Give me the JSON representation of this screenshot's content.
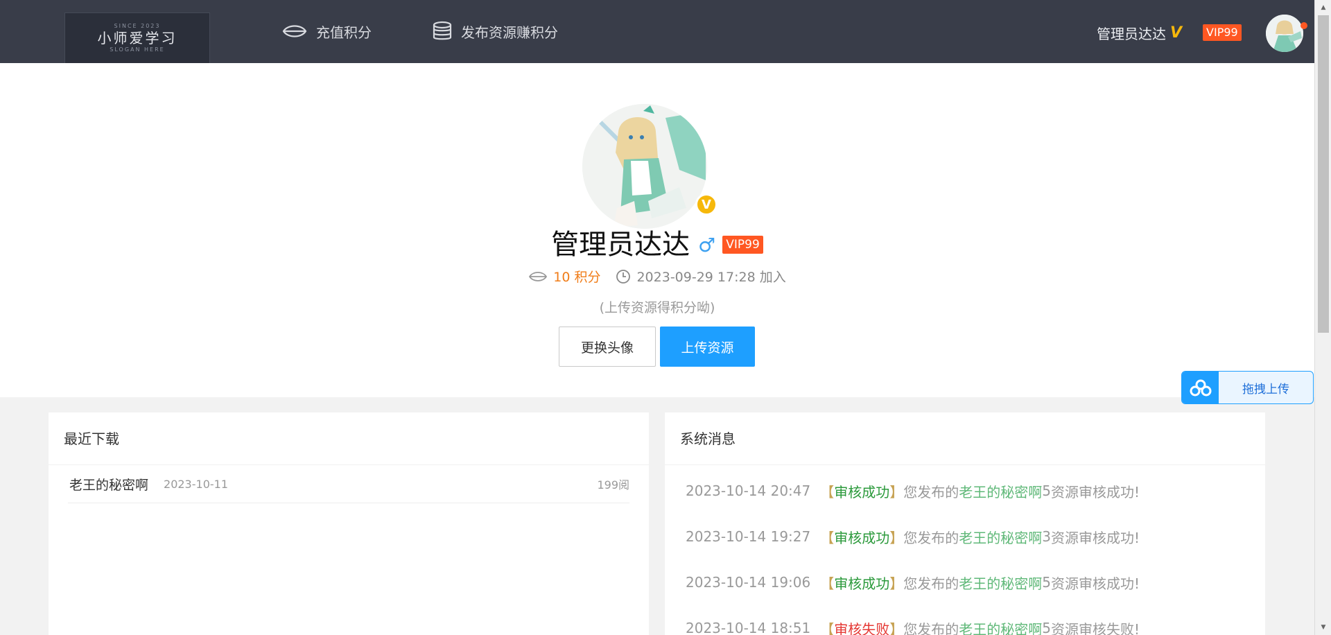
{
  "header": {
    "logo": {
      "main": "小师爱学习",
      "small": "SINCE 2023",
      "slogan": "SLOGAN HERE"
    },
    "nav": [
      {
        "label": "充值积分",
        "icon": "coin-icon"
      },
      {
        "label": "发布资源赚积分",
        "icon": "database-icon"
      }
    ],
    "user": {
      "name": "管理员达达",
      "verified": "V",
      "vip": "VIP99"
    }
  },
  "profile": {
    "name": "管理员达达",
    "gender": "♂",
    "vip": "VIP99",
    "verified_badge": "V",
    "points": "10 积分",
    "joined": "2023-09-29 17:28 加入",
    "hint": "(上传资源得积分呦)",
    "buttons": {
      "change_avatar": "更换头像",
      "upload": "上传资源"
    }
  },
  "downloads": {
    "title": "最近下载",
    "items": [
      {
        "name": "老王的秘密啊",
        "date": "2023-10-11",
        "views": "199阅"
      }
    ]
  },
  "messages": {
    "title": "系统消息",
    "items": [
      {
        "time": "2023-10-14 20:47",
        "open": "【",
        "status": "审核成功",
        "close": "】",
        "prefix": "您发布的",
        "resource": "老王的秘密啊",
        "num": "5",
        "suffix": "资源审核成功!"
      },
      {
        "time": "2023-10-14 19:27",
        "open": "【",
        "status": "审核成功",
        "close": "】",
        "prefix": "您发布的",
        "resource": "老王的秘密啊",
        "num": "3",
        "suffix": "资源审核成功!"
      },
      {
        "time": "2023-10-14 19:06",
        "open": "【",
        "status": "审核成功",
        "close": "】",
        "prefix": "您发布的",
        "resource": "老王的秘密啊",
        "num": "5",
        "suffix": "资源审核成功!"
      },
      {
        "time": "2023-10-14 18:51",
        "open": "【",
        "status": "审核失败",
        "close": "】",
        "prefix": "您发布的",
        "resource": "老王的秘密啊",
        "num": "5",
        "suffix": "资源审核失败!"
      }
    ]
  },
  "drag_upload": {
    "label": "拖拽上传"
  },
  "colors": {
    "header_bg": "#393d49",
    "accent_blue": "#1e9fff",
    "vip_orange": "#ff5722",
    "points_orange": "#f07d19",
    "success_green": "#2c9a3c",
    "fail_red": "#e53935",
    "gold": "#f6b80b"
  }
}
